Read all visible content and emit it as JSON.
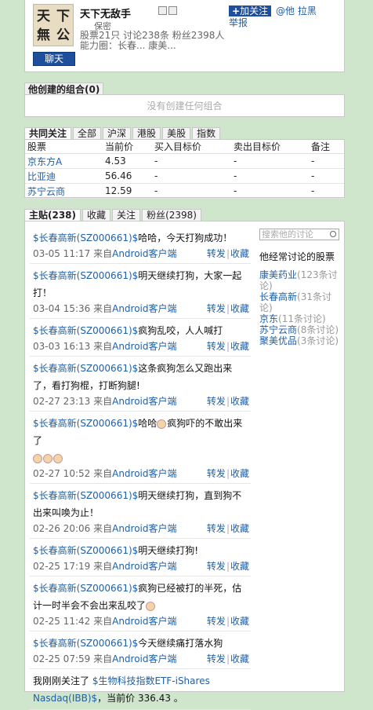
{
  "profile": {
    "avatar_text": [
      "天",
      "下",
      "無",
      "公"
    ],
    "name": "天下无敌手",
    "follow_label": "加关注",
    "at_label": "@他",
    "block_label": "拉黑",
    "report_label": "举报",
    "city": "保密",
    "stats": "股票21只  讨论238条  粉丝2398人",
    "influence": "能力圈：长春...   康美...",
    "chat_label": "聊天"
  },
  "portfolio": {
    "title": "他创建的组合",
    "count": "(0)",
    "empty_text": "没有创建任何组合"
  },
  "stock_tabs": [
    "共同关注",
    "全部",
    "沪深",
    "港股",
    "美股",
    "指数"
  ],
  "stock_table": {
    "headers": [
      "股票",
      "当前价",
      "买入目标价",
      "卖出目标价",
      "备注"
    ],
    "rows": [
      {
        "name": "京东方A",
        "price": "4.53",
        "buy": "-",
        "sell": "-",
        "note": "-"
      },
      {
        "name": "比亚迪",
        "price": "56.46",
        "buy": "-",
        "sell": "-",
        "note": "-"
      },
      {
        "name": "苏宁云商",
        "price": "12.59",
        "buy": "-",
        "sell": "-",
        "note": "-"
      }
    ]
  },
  "post_tabs": [
    "主贴(238)",
    "收藏",
    "关注",
    "粉丝(2398)"
  ],
  "posts": [
    {
      "tag": "$长春高新(SZ000661)$",
      "text": "哈哈，今天打狗成功！",
      "time": "03-05 11:17",
      "src_pre": "来自",
      "src": "Android客户端",
      "emo": 0,
      "emo_after": 0
    },
    {
      "tag": "$长春高新(SZ000661)$",
      "text": "明天继续打狗，大家一起打！",
      "time": "03-04 15:36",
      "src_pre": "来自",
      "src": "Android客户端",
      "emo": 0,
      "emo_after": 0
    },
    {
      "tag": "$长春高新(SZ000661)$",
      "text": "疯狗乱咬，人人喊打",
      "time": "03-03 16:13",
      "src_pre": "来自",
      "src": "Android客户端",
      "emo": 0,
      "emo_after": 0
    },
    {
      "tag": "$长春高新(SZ000661)$",
      "text": "这条疯狗怎么又跑出来了，看打狗棍，打断狗腿!",
      "time": "02-27 23:13",
      "src_pre": "来自",
      "src": "Android客户端",
      "emo": 0,
      "emo_after": 0
    },
    {
      "tag": "$长春高新(SZ000661)$",
      "text": "哈哈疯狗吓的不敢出来了",
      "time": "02-27 10:52",
      "src_pre": "来自",
      "src": "Android客户端",
      "emo": 1,
      "emo_after": 3
    },
    {
      "tag": "$长春高新(SZ000661)$",
      "text": "明天继续打狗，直到狗不出来叫唤为止！",
      "time": "02-26 20:06",
      "src_pre": "来自",
      "src": "Android客户端",
      "emo": 0,
      "emo_after": 0
    },
    {
      "tag": "$长春高新(SZ000661)$",
      "text": "明天继续打狗!",
      "time": "02-25 17:19",
      "src_pre": "来自",
      "src": "Android客户端",
      "emo": 0,
      "emo_after": 0
    },
    {
      "tag": "$长春高新(SZ000661)$",
      "text": "疯狗已经被打的半死，估计一时半会不会出来乱咬了",
      "time": "02-25 11:42",
      "src_pre": "来自",
      "src": "Android客户端",
      "emo": 0,
      "emo_after": 1
    },
    {
      "tag": "$长春高新(SZ000661)$",
      "text": "今天继续痛打落水狗",
      "time": "02-25 07:59",
      "src_pre": "来自",
      "src": "Android客户端",
      "emo": 0,
      "emo_after": 0
    }
  ],
  "last_post": {
    "pre": "我刚刚关注了 ",
    "tag": "$生物科技指数ETF-iShares Nasdaq(IBB)$",
    "post": "，当前价 336.43 。"
  },
  "post_actions": {
    "repost": "转发",
    "sep": "|",
    "fav": "收藏"
  },
  "sidebar": {
    "search_placeholder": "搜索他的讨论",
    "title": "他经常讨论的股票",
    "items": [
      {
        "name": "康美药业",
        "count": "(123条讨论)"
      },
      {
        "name": "长春高新",
        "count": "(31条讨论)"
      },
      {
        "name": "京东",
        "count": "(11条讨论)"
      },
      {
        "name": "苏宁云商",
        "count": "(8条讨论)"
      },
      {
        "name": "聚美优品",
        "count": "(3条讨论)"
      }
    ]
  }
}
